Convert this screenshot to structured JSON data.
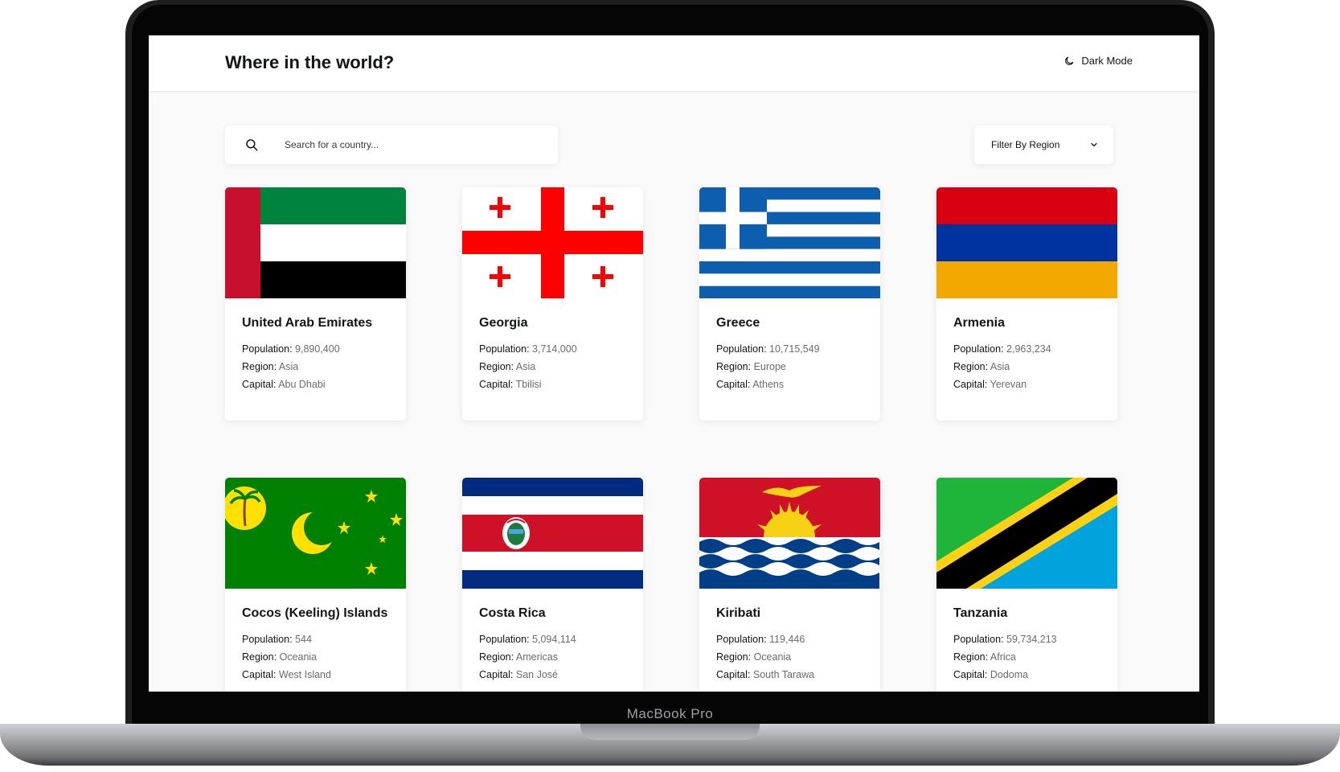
{
  "header": {
    "title": "Where in the world?",
    "dark_mode_label": "Dark Mode"
  },
  "search": {
    "placeholder": "Search for a country..."
  },
  "filter": {
    "label": "Filter By Region"
  },
  "labels": {
    "population": "Population:",
    "region": "Region:",
    "capital": "Capital:"
  },
  "countries": [
    {
      "name": "United Arab Emirates",
      "population": "9,890,400",
      "region": "Asia",
      "capital": "Abu Dhabi"
    },
    {
      "name": "Georgia",
      "population": "3,714,000",
      "region": "Asia",
      "capital": "Tbilisi"
    },
    {
      "name": "Greece",
      "population": "10,715,549",
      "region": "Europe",
      "capital": "Athens"
    },
    {
      "name": "Armenia",
      "population": "2,963,234",
      "region": "Asia",
      "capital": "Yerevan"
    },
    {
      "name": "Cocos (Keeling) Islands",
      "population": "544",
      "region": "Oceania",
      "capital": "West Island"
    },
    {
      "name": "Costa Rica",
      "population": "5,094,114",
      "region": "Americas",
      "capital": "San José"
    },
    {
      "name": "Kiribati",
      "population": "119,446",
      "region": "Oceania",
      "capital": "South Tarawa"
    },
    {
      "name": "Tanzania",
      "population": "59,734,213",
      "region": "Africa",
      "capital": "Dodoma"
    }
  ],
  "device": {
    "label": "MacBook Pro"
  }
}
